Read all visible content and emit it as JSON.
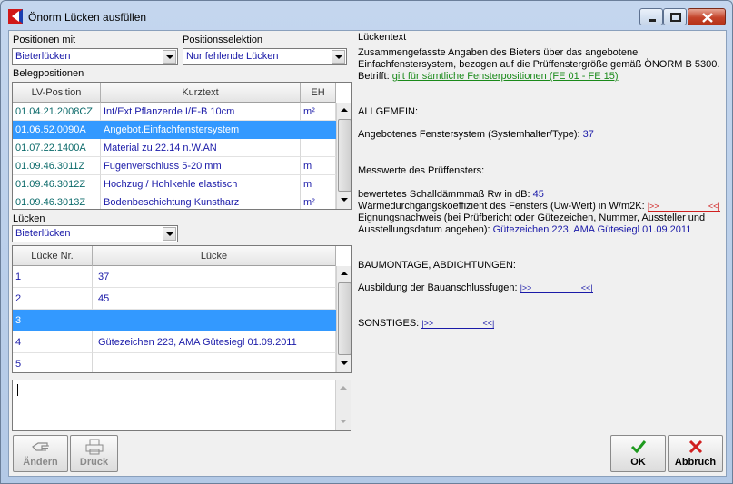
{
  "window": {
    "title": "Önorm Lücken ausfüllen"
  },
  "left": {
    "positionen_mit_label": "Positionen mit",
    "positionen_mit_value": "Bieterlücken",
    "positionsselektion_label": "Positionsselektion",
    "positionsselektion_value": "Nur fehlende Lücken",
    "belegpositionen_label": "Belegpositionen",
    "positions_table": {
      "headers": [
        "LV-Position",
        "Kurztext",
        "EH"
      ],
      "rows": [
        [
          "01.04.21.2008CZ",
          "Int/Ext.Pflanzerde I/E-B 10cm",
          "m²"
        ],
        [
          "01.06.52.0090A",
          "Angebot.Einfachfenstersystem",
          ""
        ],
        [
          "01.07.22.1400A",
          "Material zu 22.14 n.W.AN",
          ""
        ],
        [
          "01.09.46.3011Z",
          "Fugenverschluss 5-20 mm",
          "m"
        ],
        [
          "01.09.46.3012Z",
          "Hochzug / Hohlkehle elastisch",
          "m"
        ],
        [
          "01.09.46.3013Z",
          "Bodenbeschichtung Kunstharz",
          "m²"
        ]
      ],
      "selected_index": 1
    },
    "luecken_label": "Lücken",
    "luecken_value": "Bieterlücken",
    "gaps_table": {
      "headers": [
        "Lücke Nr.",
        "Lücke"
      ],
      "rows": [
        [
          "1",
          "37"
        ],
        [
          "2",
          "45"
        ],
        [
          "3",
          ""
        ],
        [
          "4",
          "Gütezeichen 223, AMA Gütesiegl 01.09.2011"
        ],
        [
          "5",
          ""
        ]
      ],
      "selected_index": 2
    }
  },
  "right": {
    "heading": "Lückentext",
    "intro_line1": "Zusammengefasste Angaben des Bieters über das angebotene",
    "intro_line2": "Einfachfenstersystem, bezogen auf die Prüffenstergröße gemäß ÖNORM B 5300.",
    "betrifft_label": "Betrifft:",
    "betrifft_link": "gilt für sämtliche Fensterpositionen (FE 01 - FE 15)",
    "allgemein": "ALLGEMEIN:",
    "fenstersystem_label": "Angebotenes Fenstersystem (Systemhalter/Type):",
    "fenstersystem_value": "37",
    "messwerte": "Messwerte des Prüffensters:",
    "schall_label": "bewertetes Schalldämmmaß Rw in dB:",
    "schall_value": "45",
    "uw_label": "Wärmedurchgangskoeffizient des Fensters (Uw-Wert) in W/m2K:",
    "gap_start": "|>>",
    "gap_end": "<<|",
    "eignung_line1": "Eignungsnachweis (bei Prüfbericht oder Gütezeichen, Nummer, Aussteller und",
    "eignung_line2": "Ausstellungsdatum angeben):",
    "eignung_value": "Gütezeichen 223, AMA Gütesiegl 01.09.2011",
    "baumontage": "BAUMONTAGE, ABDICHTUNGEN:",
    "bauanschluss_label": "Ausbildung der Bauanschlussfugen:",
    "sonstiges_label": "SONSTIGES:"
  },
  "buttons": {
    "aendern": "Ändern",
    "druck": "Druck",
    "ok": "OK",
    "abbruch": "Abbruch"
  },
  "colors": {
    "selection": "#3399ff",
    "value_blue": "#1a1aa8",
    "code_teal": "#0b6a6a",
    "link_green": "#1a8a1a",
    "gap_red": "#d02020"
  }
}
